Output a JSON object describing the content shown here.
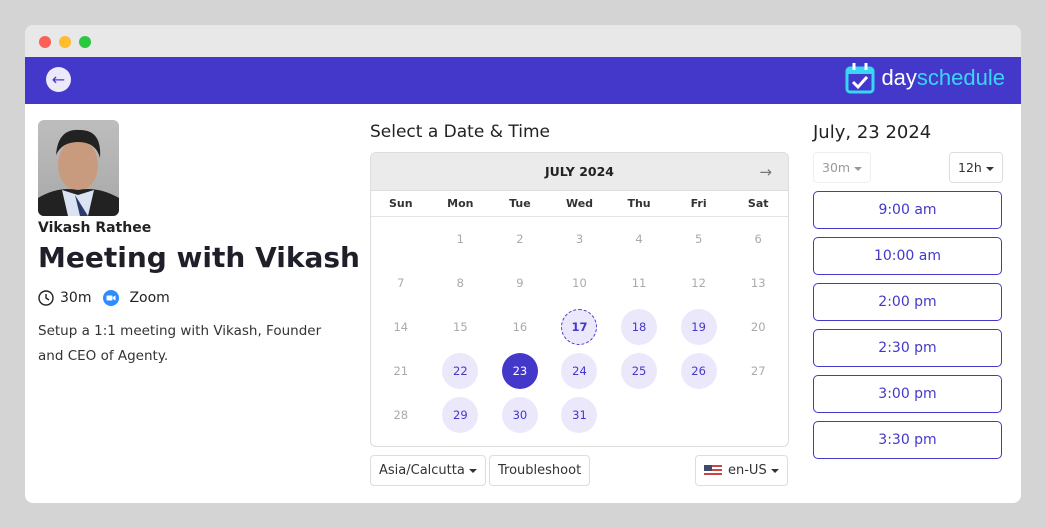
{
  "brand": {
    "name_a": "day",
    "name_b": "schedule",
    "accent": "#4338ca"
  },
  "host": {
    "name": "Vikash Rathee"
  },
  "event": {
    "title": "Meeting with Vikash",
    "duration": "30m",
    "location": "Zoom",
    "description": "Setup a 1:1 meeting with Vikash, Founder and CEO of Agenty."
  },
  "calendar": {
    "heading": "Select a Date & Time",
    "month": "JULY 2024",
    "weekdays": [
      "Sun",
      "Mon",
      "Tue",
      "Wed",
      "Thu",
      "Fri",
      "Sat"
    ],
    "start_offset": 1,
    "days_in_month": 31,
    "today": 17,
    "selected": 23,
    "available": [
      17,
      18,
      19,
      22,
      23,
      24,
      25,
      26,
      29,
      30,
      31
    ]
  },
  "footer": {
    "timezone": "Asia/Calcutta",
    "troubleshoot": "Troubleshoot",
    "locale": "en-US"
  },
  "slots": {
    "date": "July, 23 2024",
    "duration": "30m",
    "format": "12h",
    "times": [
      "9:00 am",
      "10:00 am",
      "2:00 pm",
      "2:30 pm",
      "3:00 pm",
      "3:30 pm"
    ]
  }
}
